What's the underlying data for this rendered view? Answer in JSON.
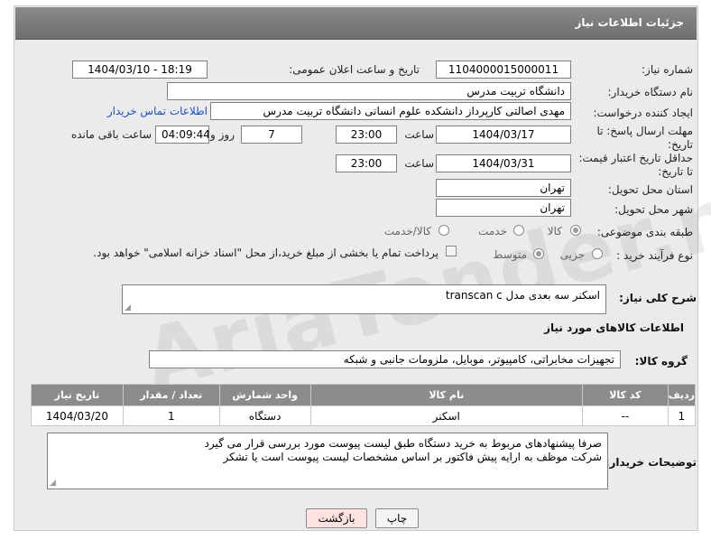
{
  "header": {
    "title": "جزئیات اطلاعات نیاز"
  },
  "watermark": "AriaTender.neT",
  "labels": {
    "need_number": "شماره نیاز:",
    "announce_datetime": "تاریخ و ساعت اعلان عمومی:",
    "buyer_org": "نام دستگاه خریدار:",
    "requester": "ایجاد کننده درخواست:",
    "contact_link": "اطلاعات تماس خریدار",
    "reply_deadline": "مهلت ارسال پاسخ: تا تاریخ:",
    "time": "ساعت",
    "day_and": "روز و",
    "time_remaining": "ساعت باقی مانده",
    "price_validity": "حداقل تاریخ اعتبار قیمت: تا تاریخ:",
    "delivery_province": "استان محل تحویل:",
    "delivery_city": "شهر محل تحویل:",
    "category": "طبقه بندی موضوعی:",
    "process_type": "نوع فرآیند خرید :",
    "general_desc": "شرح کلی نیاز:",
    "goods_info": "اطلاعات کالاهای مورد نیاز",
    "goods_group": "گروه کالا:",
    "buyer_notes": "توضیحات خریدار:"
  },
  "values": {
    "need_number": "1104000015000011",
    "announce_datetime": "1404/03/10 - 18:19",
    "buyer_org": "دانشگاه تربیت مدرس",
    "requester": "مهدی اصالتی کارپرداز دانشکده علوم انسانی دانشگاه تربیت مدرس",
    "reply_date": "1404/03/17",
    "reply_time": "23:00",
    "days": "7",
    "remaining": "04:09:44",
    "price_date": "1404/03/31",
    "price_time": "23:00",
    "province": "تهران",
    "city": "تهران",
    "general_desc": "اسکنر سه بعدی مدل transcan c",
    "goods_group": "تجهیزات مخابراتی، کامپیوتر، موبایل، ملزومات جانبی و شبکه",
    "buyer_notes_line1": "صرفا پیشنهادهای مربوط به خرید دستگاه طبق لیست پیوست مورد بررسی قرار می گیرد",
    "buyer_notes_line2": "شرکت موظف به ارایه پیش فاکتور بر اساس مشخصات لیست پیوست است یا تشکر"
  },
  "category_options": {
    "goods": "کالا",
    "service": "خدمت",
    "goods_service": "کالا/خدمت",
    "selected": "کالا"
  },
  "process_options": {
    "partial": "جزیی",
    "medium": "متوسط",
    "selected": "متوسط",
    "payment_note": "پرداخت تمام یا بخشی از مبلغ خرید،از محل \"اسناد خزانه اسلامی\" خواهد بود."
  },
  "table": {
    "headers": [
      "ردیف",
      "کد کالا",
      "نام کالا",
      "واحد شمارش",
      "تعداد / مقدار",
      "تاریخ نیاز"
    ],
    "rows": [
      {
        "row": "1",
        "code": "--",
        "name": "اسکنر",
        "unit": "دستگاه",
        "qty": "1",
        "date": "1404/03/20"
      }
    ]
  },
  "buttons": {
    "print": "چاپ",
    "back": "بازگشت"
  },
  "colors": {
    "header_bg": "#7a7a7a",
    "link": "#1a4fd6",
    "back_btn_bg": "#fde2e2",
    "panel_bg": "#ebebeb"
  }
}
